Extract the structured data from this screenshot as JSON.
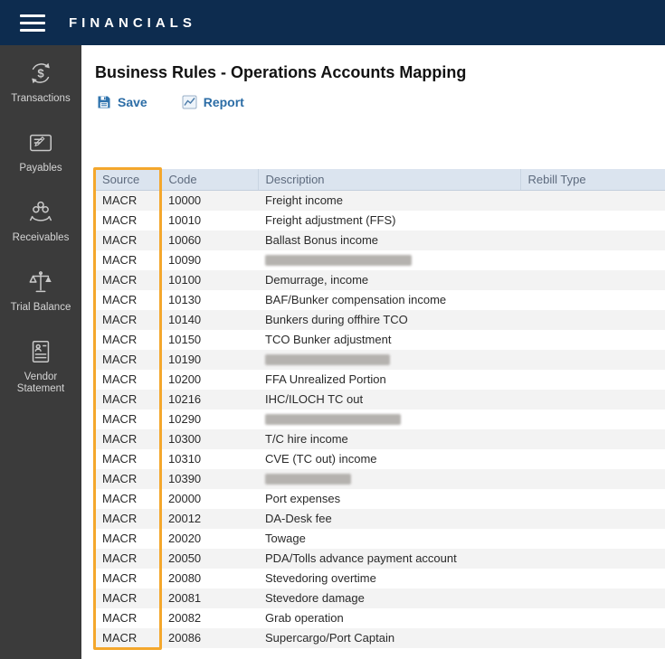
{
  "topbar": {
    "title": "FINANCIALS",
    "menu_icon": "hamburger-menu-icon"
  },
  "sidebar": {
    "items": [
      {
        "label": "Transactions",
        "icon": "transactions-icon"
      },
      {
        "label": "Payables",
        "icon": "payables-icon"
      },
      {
        "label": "Receivables",
        "icon": "receivables-icon"
      },
      {
        "label": "Trial Balance",
        "icon": "trial-balance-icon"
      },
      {
        "label": "Vendor Statement",
        "icon": "vendor-statement-icon"
      }
    ]
  },
  "page": {
    "title": "Business Rules - Operations Accounts Mapping"
  },
  "toolbar": {
    "save_label": "Save",
    "save_icon": "save-floppy-icon",
    "report_label": "Report",
    "report_icon": "report-chart-icon"
  },
  "table": {
    "columns": [
      "Source",
      "Code",
      "Description",
      "Rebill Type"
    ],
    "highlight": {
      "column": "Source",
      "color": "#f4a72c"
    },
    "rows": [
      {
        "source": "MACR",
        "code": "10000",
        "description": "Freight income",
        "rebill_type": "",
        "redacted": false
      },
      {
        "source": "MACR",
        "code": "10010",
        "description": "Freight adjustment (FFS)",
        "rebill_type": "",
        "redacted": false
      },
      {
        "source": "MACR",
        "code": "10060",
        "description": "Ballast Bonus income",
        "rebill_type": "",
        "redacted": false
      },
      {
        "source": "MACR",
        "code": "10090",
        "description": "",
        "rebill_type": "",
        "redacted": true,
        "redact_width": 162
      },
      {
        "source": "MACR",
        "code": "10100",
        "description": "Demurrage, income",
        "rebill_type": "",
        "redacted": false
      },
      {
        "source": "MACR",
        "code": "10130",
        "description": "BAF/Bunker compensation income",
        "rebill_type": "",
        "redacted": false
      },
      {
        "source": "MACR",
        "code": "10140",
        "description": "Bunkers during offhire TCO",
        "rebill_type": "",
        "redacted": false
      },
      {
        "source": "MACR",
        "code": "10150",
        "description": "TCO Bunker adjustment",
        "rebill_type": "",
        "redacted": false
      },
      {
        "source": "MACR",
        "code": "10190",
        "description": "",
        "rebill_type": "",
        "redacted": true,
        "redact_width": 138
      },
      {
        "source": "MACR",
        "code": "10200",
        "description": "FFA Unrealized Portion",
        "rebill_type": "",
        "redacted": false
      },
      {
        "source": "MACR",
        "code": "10216",
        "description": "IHC/ILOCH TC out",
        "rebill_type": "",
        "redacted": false
      },
      {
        "source": "MACR",
        "code": "10290",
        "description": "",
        "rebill_type": "",
        "redacted": true,
        "redact_width": 150
      },
      {
        "source": "MACR",
        "code": "10300",
        "description": "T/C hire income",
        "rebill_type": "",
        "redacted": false
      },
      {
        "source": "MACR",
        "code": "10310",
        "description": "CVE (TC out) income",
        "rebill_type": "",
        "redacted": false
      },
      {
        "source": "MACR",
        "code": "10390",
        "description": "",
        "rebill_type": "",
        "redacted": true,
        "redact_width": 95
      },
      {
        "source": "MACR",
        "code": "20000",
        "description": "Port expenses",
        "rebill_type": "",
        "redacted": false
      },
      {
        "source": "MACR",
        "code": "20012",
        "description": "DA-Desk fee",
        "rebill_type": "",
        "redacted": false
      },
      {
        "source": "MACR",
        "code": "20020",
        "description": "Towage",
        "rebill_type": "",
        "redacted": false
      },
      {
        "source": "MACR",
        "code": "20050",
        "description": "PDA/Tolls advance payment account",
        "rebill_type": "",
        "redacted": false
      },
      {
        "source": "MACR",
        "code": "20080",
        "description": "Stevedoring overtime",
        "rebill_type": "",
        "redacted": false
      },
      {
        "source": "MACR",
        "code": "20081",
        "description": "Stevedore damage",
        "rebill_type": "",
        "redacted": false
      },
      {
        "source": "MACR",
        "code": "20082",
        "description": "Grab operation",
        "rebill_type": "",
        "redacted": false
      },
      {
        "source": "MACR",
        "code": "20086",
        "description": "Supercargo/Port Captain",
        "rebill_type": "",
        "redacted": false
      }
    ]
  }
}
